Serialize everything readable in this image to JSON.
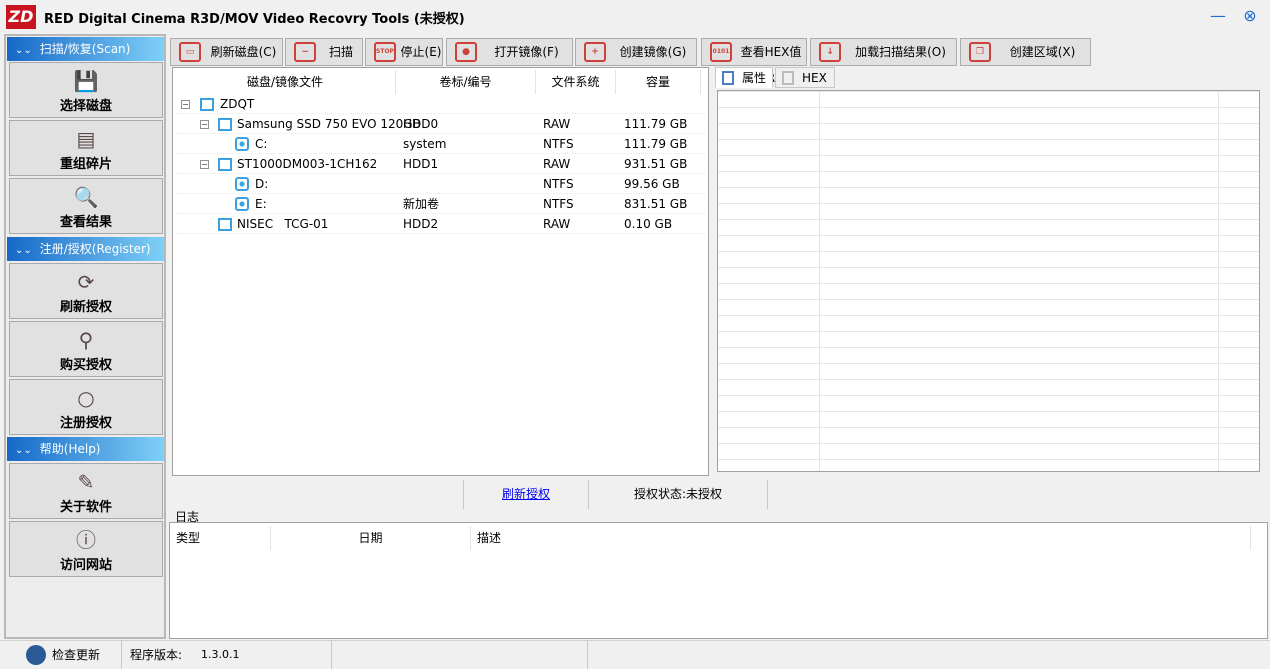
{
  "window": {
    "logo": "ZD",
    "title": "RED Digital Cinema R3D/MOV Video Recovry Tools  (未授权)",
    "minimize": "—",
    "close": "⊗"
  },
  "sidebar": {
    "sections": [
      {
        "label": "扫描/恢复(Scan)",
        "items": [
          {
            "label": "选择磁盘",
            "icon": "save-disk-icon",
            "glyph": "💾"
          },
          {
            "label": "重组碎片",
            "icon": "fragments-icon",
            "glyph": "▤"
          },
          {
            "label": "查看结果",
            "icon": "view-results-icon",
            "glyph": "🔍"
          }
        ]
      },
      {
        "label": "注册/授权(Register)",
        "items": [
          {
            "label": "刷新授权",
            "icon": "refresh-icon",
            "glyph": "⟳"
          },
          {
            "label": "购买授权",
            "icon": "key-search-icon",
            "glyph": "⚲"
          },
          {
            "label": "注册授权",
            "icon": "magnifier-icon",
            "glyph": "○"
          }
        ]
      },
      {
        "label": "帮助(Help)",
        "items": [
          {
            "label": "关于软件",
            "icon": "document-edit-icon",
            "glyph": "✎"
          },
          {
            "label": "访问网站",
            "icon": "info-icon",
            "glyph": "ⓘ"
          }
        ]
      }
    ]
  },
  "toolbar": [
    {
      "label": "刷新磁盘(C)",
      "icon": "disk-refresh-icon",
      "glyph": "▭"
    },
    {
      "label": "扫描(D)",
      "icon": "scan-icon",
      "glyph": "~"
    },
    {
      "label": "停止(E)",
      "icon": "stop-icon",
      "glyph": "STOP"
    },
    {
      "label": "打开镜像(F)",
      "icon": "open-image-icon",
      "glyph": "●"
    },
    {
      "label": "创建镜像(G)",
      "icon": "create-image-icon",
      "glyph": "+"
    },
    {
      "label": "查看HEX值(R)",
      "icon": "hex-file-icon",
      "glyph": "0101"
    },
    {
      "label": "加载扫描结果(O)",
      "icon": "download-icon",
      "glyph": "↓"
    },
    {
      "label": "创建区域(X)",
      "icon": "copy-region-icon",
      "glyph": "❐"
    }
  ],
  "tree": {
    "headers": [
      "磁盘/镜像文件",
      "卷标/编号",
      "文件系统",
      "容量"
    ],
    "rows": [
      {
        "name": "ZDQT",
        "label": "",
        "fs": "",
        "size": ""
      },
      {
        "name": "Samsung SSD 750 EVO 120GB",
        "label": "HDD0",
        "fs": "RAW",
        "size": "111.79 GB"
      },
      {
        "name": "C:",
        "label": "system",
        "fs": "NTFS",
        "size": "111.79 GB"
      },
      {
        "name": "ST1000DM003-1CH162",
        "label": "HDD1",
        "fs": "RAW",
        "size": "931.51 GB"
      },
      {
        "name": "D:",
        "label": "",
        "fs": "NTFS",
        "size": "99.56 GB"
      },
      {
        "name": "E:",
        "label": "新加卷",
        "fs": "NTFS",
        "size": "831.51 GB"
      },
      {
        "name": "NISEC   TCG-01",
        "label": "HDD2",
        "fs": "RAW",
        "size": "0.10 GB"
      }
    ]
  },
  "right_tabs": [
    "属性",
    "HEX值"
  ],
  "midbar": {
    "refresh_link": "刷新授权",
    "auth_status": "授权状态:未授权"
  },
  "log": {
    "title": "日志",
    "headers": [
      "类型",
      "日期",
      "描述"
    ]
  },
  "statusbar": {
    "check_update": "检查更新",
    "version_label": "程序版本:",
    "version": "1.3.0.1"
  }
}
